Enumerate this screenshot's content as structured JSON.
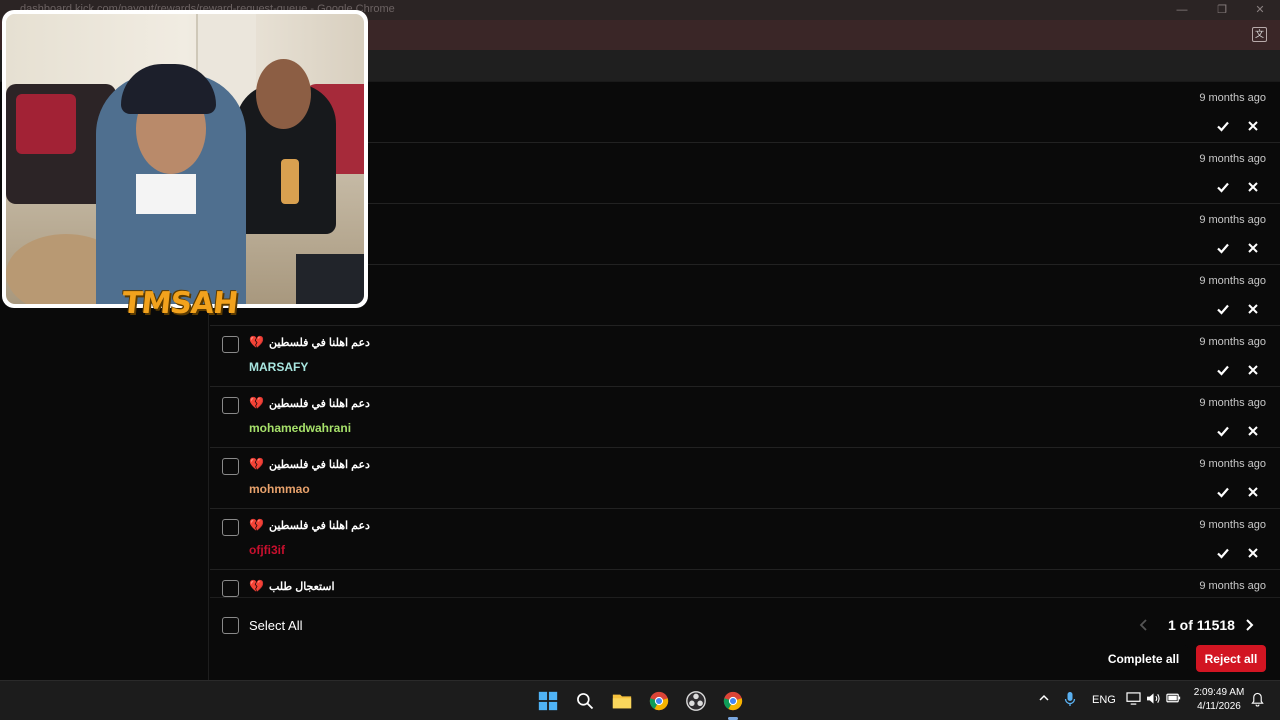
{
  "window": {
    "title": "dashboard.kick.com/payout/rewards/reward-request-queue - Google Chrome",
    "minimize": "—",
    "maximize": "❐",
    "close": "✕"
  },
  "rows": [
    {
      "reward": "",
      "user": "",
      "user_color": "#ffffff",
      "time": "9 months ago"
    },
    {
      "reward": "",
      "user": "",
      "user_color": "#ffffff",
      "time": "9 months ago"
    },
    {
      "reward": "",
      "user": "",
      "user_color": "#ffffff",
      "time": "9 months ago"
    },
    {
      "reward": "",
      "user": "",
      "user_color": "#ffffff",
      "time": "9 months ago"
    },
    {
      "reward": "دعم اهلنا في فلسطين",
      "user": "MARSAFY",
      "user_color": "#a8e6e0",
      "time": "9 months ago"
    },
    {
      "reward": "دعم اهلنا في فلسطين",
      "user": "mohamedwahrani",
      "user_color": "#a6e06a",
      "time": "9 months ago"
    },
    {
      "reward": "دعم اهلنا في فلسطين",
      "user": "mohmmao",
      "user_color": "#e8a26c",
      "time": "9 months ago"
    },
    {
      "reward": "دعم اهلنا في فلسطين",
      "user": "ofjfi3if",
      "user_color": "#c8102e",
      "time": "9 months ago"
    },
    {
      "reward": "استعجال طلب",
      "user": "",
      "user_color": "#ffffff",
      "time": "9 months ago"
    }
  ],
  "footer": {
    "select_all": "Select All",
    "pager": "1 of 11518",
    "complete_all": "Complete all",
    "reject_all": "Reject all"
  },
  "overlay": {
    "logo": "TMSAH"
  },
  "taskbar": {
    "language": "ENG",
    "time": "2:09:49 AM",
    "date": "4/11/2026"
  },
  "colors": {
    "accent_red": "#d21522",
    "background": "#0a0a0a"
  }
}
